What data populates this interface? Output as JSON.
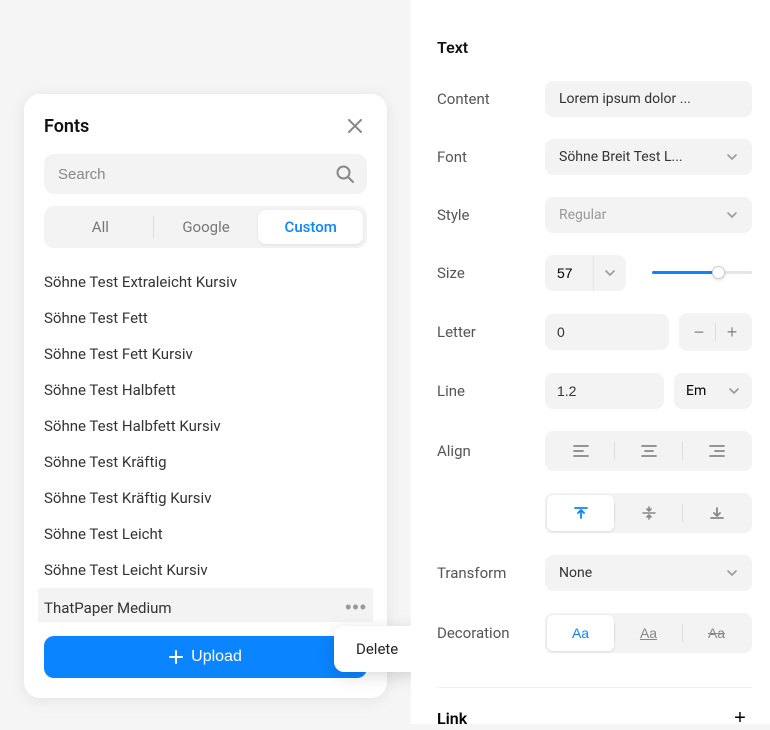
{
  "fonts_modal": {
    "title": "Fonts",
    "search_placeholder": "Search",
    "tabs": {
      "all": "All",
      "google": "Google",
      "custom": "Custom"
    },
    "items": [
      "Söhne Test Extraleicht Kursiv",
      "Söhne Test Fett",
      "Söhne Test Fett Kursiv",
      "Söhne Test Halbfett",
      "Söhne Test Halbfett Kursiv",
      "Söhne Test Kräftig",
      "Söhne Test Kräftig Kursiv",
      "Söhne Test Leicht",
      "Söhne Test Leicht Kursiv",
      "ThatPaper Medium"
    ],
    "upload": "Upload",
    "context_delete": "Delete"
  },
  "text_panel": {
    "title": "Text",
    "labels": {
      "content": "Content",
      "font": "Font",
      "style": "Style",
      "size": "Size",
      "letter": "Letter",
      "line": "Line",
      "align": "Align",
      "transform": "Transform",
      "decoration": "Decoration"
    },
    "values": {
      "content": "Lorem ipsum dolor ...",
      "font": "Söhne Breit Test L...",
      "style": "Regular",
      "size": "57",
      "letter": "0",
      "line": "1.2",
      "line_unit": "Em",
      "transform": "None",
      "deco": "Aa"
    }
  },
  "link_section": {
    "title": "Link"
  }
}
